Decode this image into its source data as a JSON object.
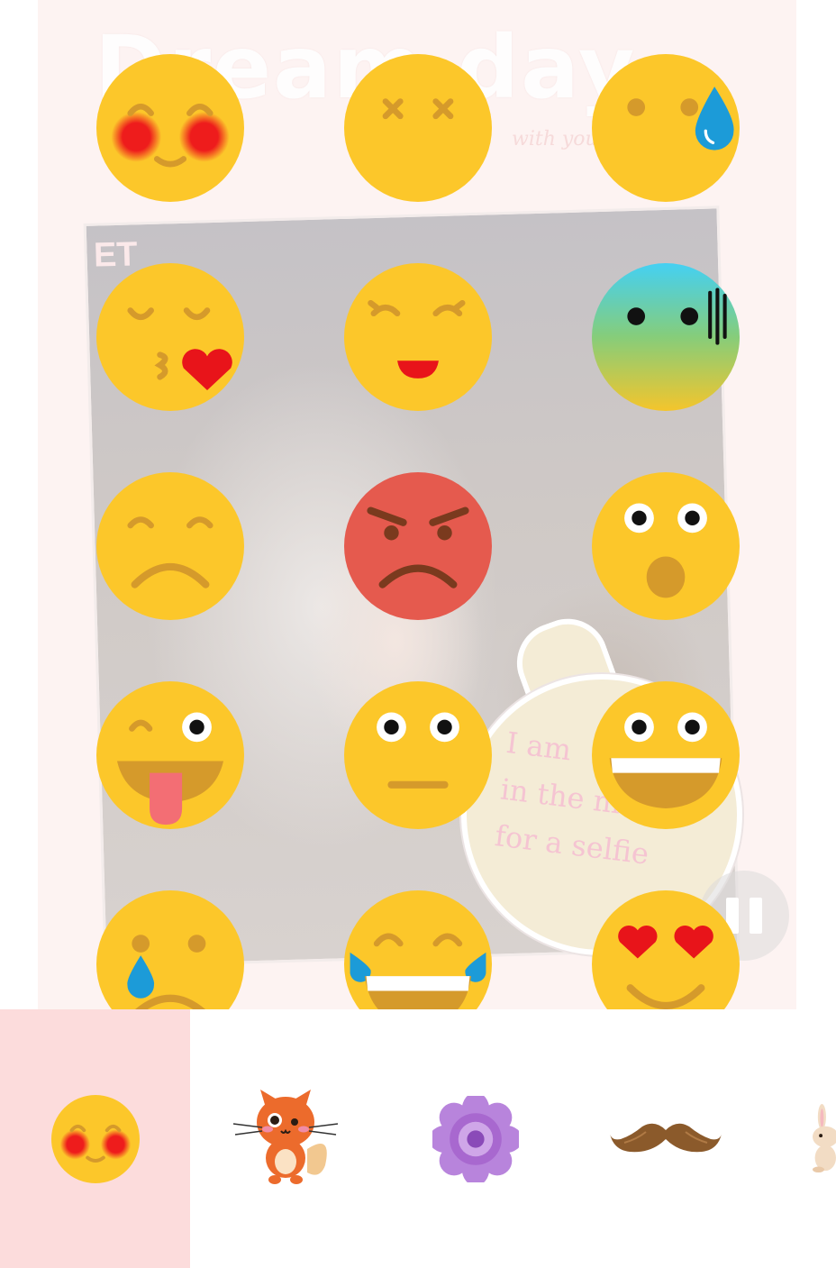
{
  "canvas": {
    "background_title": "Dream day",
    "background_tag": "with you baby",
    "photo_logo": "ET",
    "bubble_text": "I am\nin the mood\nfor a selfie"
  },
  "sticker_grid": [
    "blushing-face",
    "dizzy-face",
    "sweat-drop-face",
    "kissing-heart-face",
    "happy-squint-face",
    "cold-face",
    "sad-face",
    "angry-face",
    "surprised-face",
    "winking-tongue-face",
    "neutral-face",
    "grinning-face",
    "crying-face",
    "tears-of-joy-face",
    "heart-eyes-face"
  ],
  "category_tray": {
    "selected_index": 0,
    "items": [
      "emoji-category",
      "fox-category",
      "flower-category",
      "mustache-category",
      "bunny-category"
    ]
  },
  "colors": {
    "emoji_yellow": "#fcc72a",
    "emoji_features": "#d59a2b",
    "angry_red": "#e55a4e",
    "blush": "#ee1c1c",
    "tray_selected": "#fcdcdc",
    "poster_bg": "#fdf3f2"
  }
}
